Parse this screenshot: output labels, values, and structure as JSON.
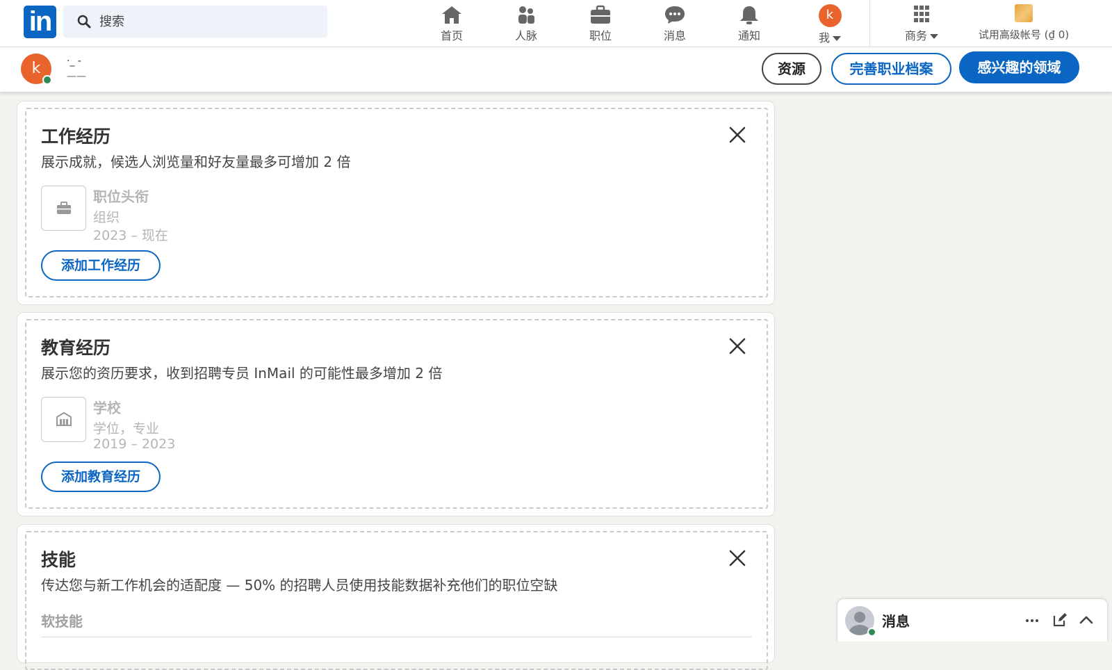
{
  "topnav": {
    "logo_text": "in",
    "search_placeholder": "搜索",
    "items": [
      {
        "label": "首页",
        "icon": "home-icon"
      },
      {
        "label": "人脉",
        "icon": "network-icon"
      },
      {
        "label": "职位",
        "icon": "jobs-icon"
      },
      {
        "label": "消息",
        "icon": "messaging-icon"
      },
      {
        "label": "通知",
        "icon": "bell-icon"
      },
      {
        "label": "我",
        "icon": "avatar"
      },
      {
        "label": "商务",
        "icon": "grid-icon"
      }
    ],
    "me_avatar_letter": "k",
    "premium_label": "试用高级帐号 (₫ 0)"
  },
  "profilebar": {
    "avatar_letter": "k",
    "name": "·_ -",
    "subtitle": "——",
    "buttons": {
      "resources": "资源",
      "complete_profile": "完善职业档案",
      "interests": "感兴趣的领域"
    }
  },
  "cards": {
    "experience": {
      "title": "工作经历",
      "description": "展示成就，候选人浏览量和好友量最多可增加 2 倍",
      "placeholder_title": "职位头衔",
      "placeholder_org": "组织",
      "placeholder_dates": "2023 – 现在",
      "add_button": "添加工作经历"
    },
    "education": {
      "title": "教育经历",
      "description": "展示您的资历要求，收到招聘专员 InMail 的可能性最多增加 2 倍",
      "placeholder_title": "学校",
      "placeholder_org": "学位，专业",
      "placeholder_dates": "2019 – 2023",
      "add_button": "添加教育经历"
    },
    "skills": {
      "title": "技能",
      "description": "传达您与新工作机会的适配度 — 50% 的招聘人员使用技能数据补充他们的职位空缺",
      "first_item": "软技能"
    }
  },
  "messaging_dock": {
    "label": "消息"
  },
  "colors": {
    "brand": "#0a66c2",
    "avatar": "#e8642c",
    "online": "#2e8b57",
    "page_bg": "#f4f2ee"
  }
}
